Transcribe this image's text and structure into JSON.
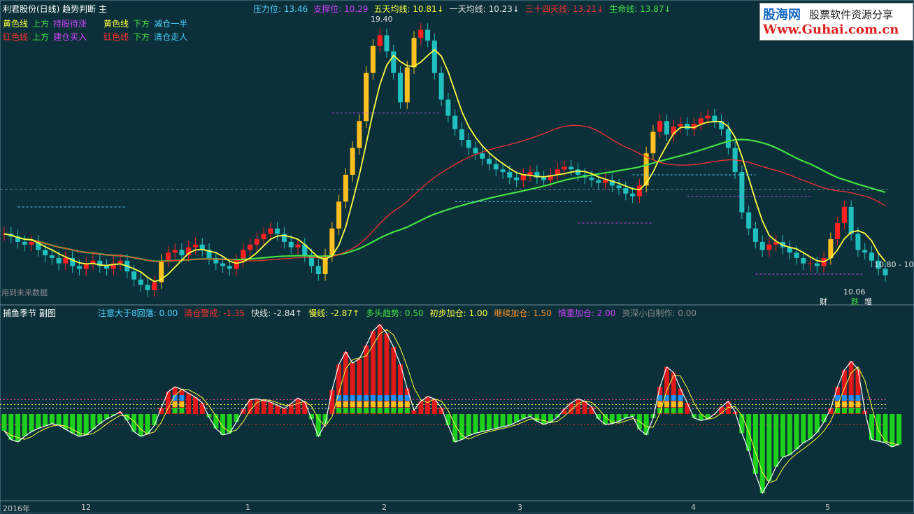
{
  "main_panel": {
    "title": "利君股份(日线) 趋势判断 主",
    "indicators": [
      {
        "label": "压力位",
        "value": "13.46",
        "color": "#4fd1ff"
      },
      {
        "label": "支撑位",
        "value": "10.29",
        "color": "#d040ff"
      },
      {
        "label": "五天均线",
        "value": "10.81",
        "arrow": "↓",
        "color": "#ffff40"
      },
      {
        "label": "一天均线",
        "value": "10.23",
        "arrow": "↓",
        "color": "#e0e0e0"
      },
      {
        "label": "三十四天线",
        "value": "13.21",
        "arrow": "↓",
        "color": "#ff3030"
      },
      {
        "label": "生命线",
        "value": "13.87",
        "arrow": "↓",
        "color": "#44e044"
      }
    ],
    "legend_rows": [
      [
        {
          "text": "黄色线",
          "color": "#ffff40"
        },
        {
          "text": "上方",
          "color": "#44e044"
        },
        {
          "text": "持股待涨",
          "color": "#d040ff"
        },
        {
          "text": "黄色线",
          "color": "#ffff40"
        },
        {
          "text": "下方",
          "color": "#44e044"
        },
        {
          "text": "减仓一半",
          "color": "#4fd1ff"
        }
      ],
      [
        {
          "text": "红色线",
          "color": "#ff3030"
        },
        {
          "text": "上方",
          "color": "#44e044"
        },
        {
          "text": "建仓买入",
          "color": "#d040ff"
        },
        {
          "text": "红色线",
          "color": "#ff3030"
        },
        {
          "text": "下方",
          "color": "#44e044"
        },
        {
          "text": "清仓走人",
          "color": "#4fd1ff"
        }
      ]
    ],
    "peak_label": "19.40",
    "low_label": "10.06",
    "price_right_label": "10.80 - 10",
    "bottom_left_note": "用到未来数据",
    "bottom_markers": [
      {
        "text": "财",
        "color": "#ffffff"
      },
      {
        "text": "跌",
        "color": "#44e044"
      },
      {
        "text": "增",
        "color": "#ffffff"
      }
    ]
  },
  "logo": {
    "brand": "股海网",
    "tagline": "股票软件资源分享",
    "url": "Www.Guhai.com.cn"
  },
  "sub_panel": {
    "title": "捕鱼季节 副图",
    "indicators": [
      {
        "label": "注意大于8回落",
        "value": "0.00",
        "color": "#4fd1ff"
      },
      {
        "label": "清仓警戒",
        "value": "-1.35",
        "color": "#ff3030"
      },
      {
        "label": "快线",
        "value": "-2.84",
        "arrow": "↑",
        "color": "#e0e0e0"
      },
      {
        "label": "慢线",
        "value": "-2.87",
        "arrow": "↑",
        "color": "#ffff40"
      },
      {
        "label": "多头趋势",
        "value": "0.50",
        "color": "#44e044"
      },
      {
        "label": "初步加仓",
        "value": "1.00",
        "color": "#ffff40"
      },
      {
        "label": "继续加仓",
        "value": "1.50",
        "color": "#ff9020"
      },
      {
        "label": "慎重加仓",
        "value": "2.00",
        "color": "#d040ff"
      },
      {
        "label": "资深小白制作",
        "value": "0.00",
        "color": "#888888"
      }
    ]
  },
  "time_axis": [
    "2016年",
    "12",
    "1",
    "2",
    "3",
    "4",
    "5"
  ],
  "colors": {
    "background": "#0b3039",
    "up_candle": "#ff2020",
    "down_candle": "#20c0c0",
    "yellow_candle": "#ffc020",
    "ma5": "#ffff40",
    "ma34": "#ff3030",
    "life": "#44e044",
    "pressure_dash": "#4fd1ff",
    "support_dash": "#d040ff"
  },
  "chart_data": {
    "type": "candlestick",
    "price_close": [
      11.6,
      11.5,
      11.3,
      11.2,
      11.3,
      11.0,
      10.8,
      10.7,
      10.5,
      10.7,
      10.4,
      10.3,
      10.5,
      10.6,
      10.4,
      10.3,
      10.5,
      10.6,
      10.2,
      9.9,
      9.7,
      9.5,
      9.8,
      10.6,
      10.9,
      11.0,
      10.8,
      11.1,
      11.2,
      11.0,
      10.7,
      10.5,
      10.4,
      10.3,
      10.6,
      11.0,
      11.2,
      11.4,
      11.6,
      11.8,
      11.6,
      11.3,
      11.1,
      11.2,
      10.8,
      10.4,
      10.1,
      10.8,
      11.8,
      12.8,
      13.8,
      14.8,
      15.8,
      17.6,
      18.6,
      19.0,
      18.4,
      17.6,
      16.5,
      17.8,
      18.9,
      19.2,
      18.8,
      17.6,
      16.6,
      16.0,
      15.5,
      15.1,
      14.8,
      14.6,
      14.4,
      14.2,
      14.0,
      13.9,
      13.7,
      13.6,
      13.8,
      13.9,
      13.7,
      13.6,
      13.8,
      14.0,
      14.1,
      14.0,
      13.8,
      13.7,
      13.6,
      13.5,
      13.6,
      13.4,
      13.3,
      13.1,
      13.0,
      13.4,
      14.6,
      15.4,
      15.8,
      15.3,
      15.6,
      15.7,
      15.5,
      15.7,
      15.9,
      16.0,
      15.8,
      15.5,
      14.8,
      13.9,
      12.4,
      11.8,
      11.3,
      11.0,
      11.2,
      11.3,
      11.1,
      10.9,
      10.7,
      10.5,
      10.5,
      10.4,
      10.7,
      11.4,
      12.0,
      12.6,
      11.6,
      11.0,
      10.9,
      10.6,
      10.3,
      10.06
    ],
    "price_min": 9.5,
    "price_max": 19.4,
    "osc_values": [
      -2.1,
      -3.2,
      -3.5,
      -2.8,
      -2.2,
      -1.8,
      -1.5,
      -1.2,
      -1.4,
      -1.9,
      -2.4,
      -2.8,
      -2.6,
      -1.9,
      -1.2,
      -0.6,
      -0.2,
      0.3,
      -0.8,
      -2.2,
      -2.8,
      -2.5,
      -1.4,
      0.8,
      2.8,
      3.4,
      3.1,
      2.6,
      2.1,
      1.4,
      -0.4,
      -1.8,
      -2.6,
      -2.4,
      -1.0,
      0.6,
      1.8,
      1.9,
      1.7,
      1.5,
      1.1,
      0.7,
      1.3,
      2.0,
      1.5,
      -0.6,
      -2.8,
      -1.2,
      3.0,
      6.2,
      7.8,
      6.4,
      6.9,
      8.6,
      10.4,
      11.2,
      10.1,
      8.4,
      6.2,
      3.2,
      0.5,
      1.6,
      2.2,
      1.9,
      0.8,
      -1.4,
      -3.5,
      -3.2,
      -2.7,
      -2.4,
      -2.2,
      -2.0,
      -1.8,
      -1.6,
      -1.4,
      -1.0,
      -0.6,
      -0.3,
      -0.9,
      -1.3,
      -1.0,
      -0.4,
      0.6,
      1.4,
      1.9,
      1.6,
      0.9,
      -0.6,
      -1.3,
      -1.2,
      -0.9,
      -0.5,
      -0.3,
      -1.9,
      -2.6,
      -0.5,
      3.4,
      5.9,
      5.2,
      3.2,
      1.4,
      -0.5,
      -0.8,
      -0.6,
      0.0,
      0.9,
      1.6,
      0.3,
      -2.4,
      -4.6,
      -7.5,
      -9.9,
      -8.4,
      -6.6,
      -5.4,
      -5.1,
      -4.4,
      -3.6,
      -3.1,
      -2.3,
      -1.0,
      0.7,
      3.4,
      5.5,
      6.6,
      5.6,
      0.4,
      -3.2,
      -3.4,
      -3.6,
      -4.1,
      -3.8
    ],
    "osc_min": -10.5,
    "osc_max": 12.0
  }
}
